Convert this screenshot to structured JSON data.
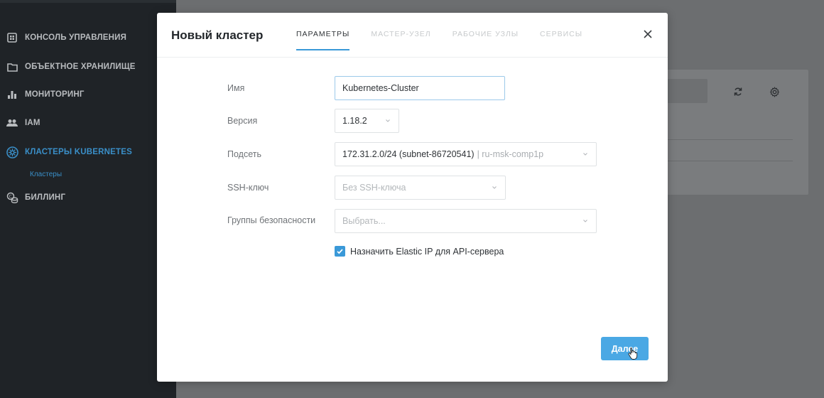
{
  "sidebar": {
    "items": [
      {
        "label": "КОНСОЛЬ УПРАВЛЕНИЯ",
        "icon": "dashboard-icon"
      },
      {
        "label": "ОБЪЕКТНОЕ ХРАНИЛИЩЕ",
        "icon": "folder-icon"
      },
      {
        "label": "МОНИТОРИНГ",
        "icon": "bar-chart-icon"
      },
      {
        "label": "IAM",
        "icon": "users-icon"
      },
      {
        "label": "КЛАСТЕРЫ KUBERNETES",
        "icon": "kubernetes-icon",
        "active": true
      },
      {
        "label": "БИЛЛИНГ",
        "icon": "billing-icon"
      }
    ],
    "sub_item": "Кластеры"
  },
  "modal": {
    "title": "Новый кластер",
    "tabs": [
      {
        "label": "ПАРАМЕТРЫ",
        "active": true
      },
      {
        "label": "МАСТЕР-УЗЕЛ"
      },
      {
        "label": "РАБОЧИЕ УЗЛЫ"
      },
      {
        "label": "СЕРВИСЫ"
      }
    ],
    "fields": {
      "name": {
        "label": "Имя",
        "value": "Kubernetes-Cluster"
      },
      "version": {
        "label": "Версия",
        "value": "1.18.2"
      },
      "subnet": {
        "label": "Подсеть",
        "value": "172.31.2.0/24 (subnet-86720541)",
        "extra": "| ru-msk-comp1p"
      },
      "ssh": {
        "label": "SSH-ключ",
        "placeholder": "Без SSH-ключа"
      },
      "security_groups": {
        "label": "Группы безопасности",
        "placeholder": "Выбрать..."
      }
    },
    "checkbox": {
      "label": "Назначить Elastic IP для API-сервера",
      "checked": true
    },
    "next_button": "Далее"
  },
  "colors": {
    "accent": "#3a99d8",
    "sidebar_bg": "#1f2327",
    "overlay": "#6c6e70"
  }
}
